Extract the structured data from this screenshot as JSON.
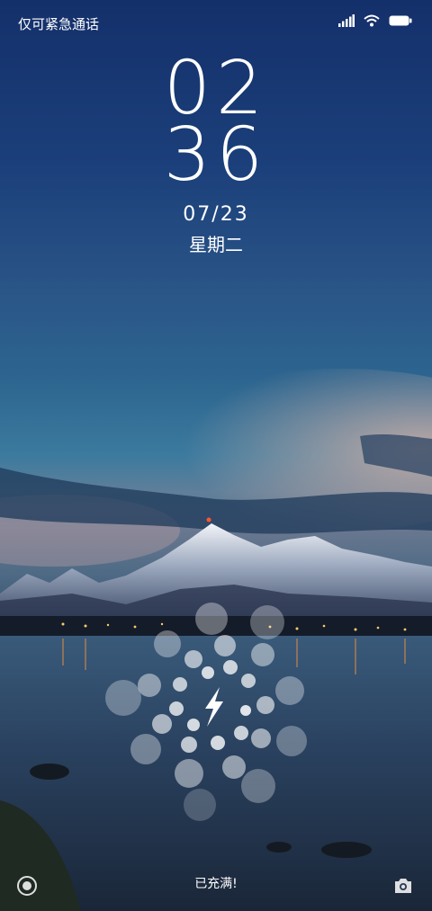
{
  "status_bar": {
    "carrier_text": "仅可紧急通话",
    "icons": [
      "signal-icon",
      "wifi-icon",
      "battery-icon"
    ]
  },
  "lockscreen": {
    "hour": "02",
    "minute": "36",
    "date": "07/23",
    "weekday": "星期二"
  },
  "charging": {
    "icon": "lightning-icon",
    "status_text": "已充满!"
  },
  "bottom_actions": {
    "left_icon": "unlock-ring-icon",
    "right_icon": "camera-icon"
  },
  "colors": {
    "sky_top": "#14306b",
    "water": "#1a2d45"
  }
}
